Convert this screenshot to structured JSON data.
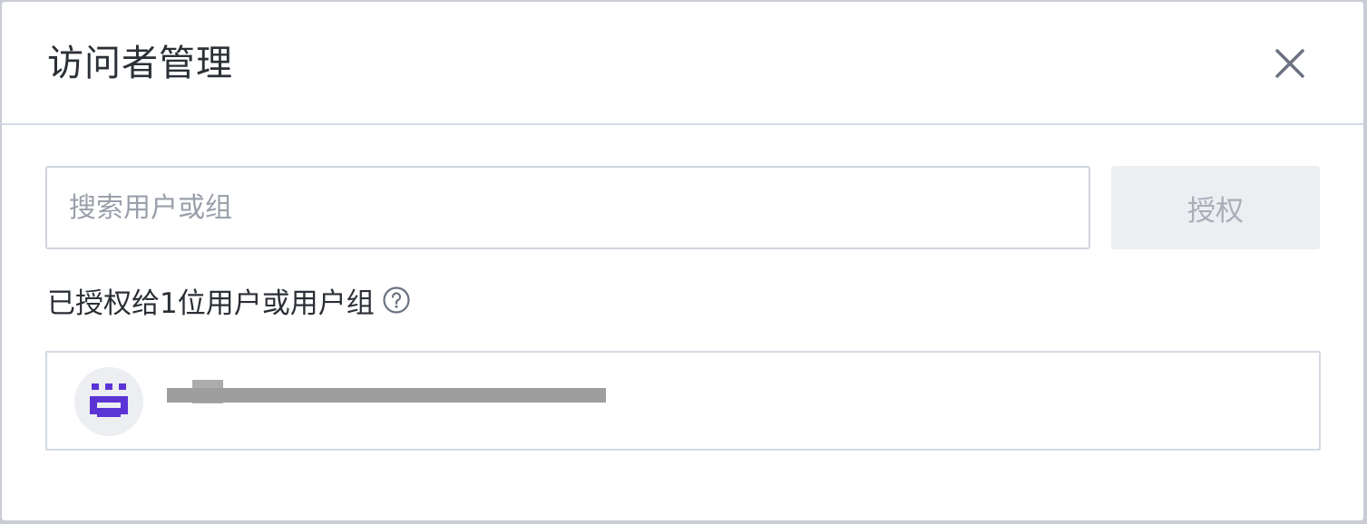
{
  "dialog": {
    "title": "访问者管理",
    "close_icon": "close-icon"
  },
  "search": {
    "placeholder": "搜索用户或组",
    "value": ""
  },
  "grant_button": {
    "label": "授权"
  },
  "authorized": {
    "summary": "已授权给1位用户或用户组",
    "help_icon": "help-circle-icon"
  },
  "members": [
    {
      "avatar_icon": "smiley-avatar-icon",
      "display_text": "",
      "avatar_color": "#5b34d6"
    }
  ],
  "colors": {
    "title": "#2b2f36",
    "placeholder": "#9aa0ab",
    "disabled_button_bg": "#eceef2",
    "disabled_button_text": "#a8adb7",
    "border": "#cfd4dd",
    "avatar_accent": "#5b34d6"
  }
}
